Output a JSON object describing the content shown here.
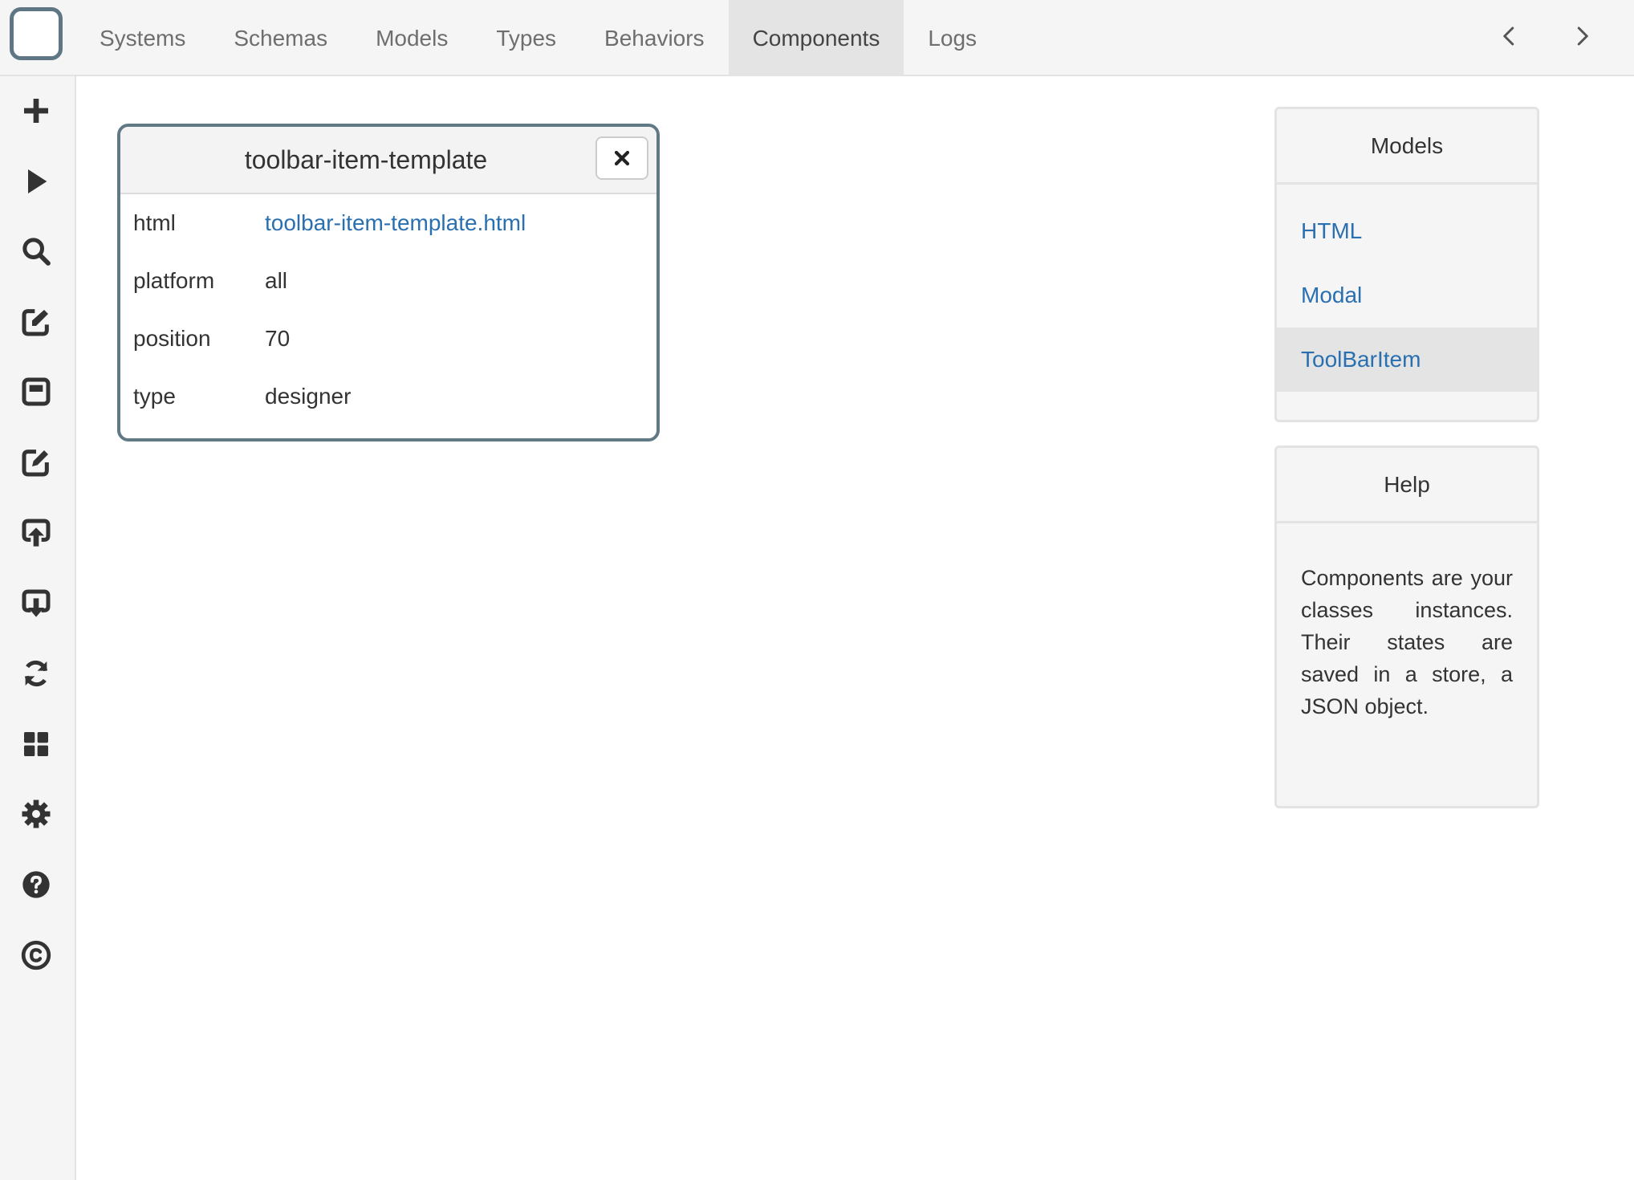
{
  "nav": {
    "tabs": [
      {
        "label": "Systems"
      },
      {
        "label": "Schemas"
      },
      {
        "label": "Models"
      },
      {
        "label": "Types"
      },
      {
        "label": "Behaviors"
      },
      {
        "label": "Components",
        "active": true
      },
      {
        "label": "Logs"
      }
    ],
    "back_icon": "chevron-left-icon",
    "forward_icon": "chevron-right-icon"
  },
  "sidebar": {
    "items": [
      {
        "icon": "plus-icon"
      },
      {
        "icon": "play-icon"
      },
      {
        "icon": "search-icon"
      },
      {
        "icon": "external-edit-icon"
      },
      {
        "icon": "window-icon"
      },
      {
        "icon": "edit-icon"
      },
      {
        "icon": "upload-icon"
      },
      {
        "icon": "download-icon"
      },
      {
        "icon": "refresh-icon"
      },
      {
        "icon": "dashboard-icon"
      },
      {
        "icon": "gear-icon"
      },
      {
        "icon": "help-icon"
      },
      {
        "icon": "copyright-icon"
      }
    ]
  },
  "component": {
    "title": "toolbar-item-template",
    "fields": [
      {
        "key": "html",
        "value": "toolbar-item-template.html",
        "link": true
      },
      {
        "key": "platform",
        "value": "all"
      },
      {
        "key": "position",
        "value": "70"
      },
      {
        "key": "type",
        "value": "designer"
      }
    ]
  },
  "models_panel": {
    "title": "Models",
    "items": [
      {
        "label": "HTML"
      },
      {
        "label": "Modal"
      },
      {
        "label": "ToolBarItem",
        "active": true
      }
    ]
  },
  "help_panel": {
    "title": "Help",
    "text": "Components are your classes instances. Their states are saved in a store, a JSON object."
  },
  "colors": {
    "link": "#2a6fb0",
    "card_border": "#607985",
    "nav_bg": "#f5f5f5",
    "active_tab_bg": "#e4e4e4"
  }
}
